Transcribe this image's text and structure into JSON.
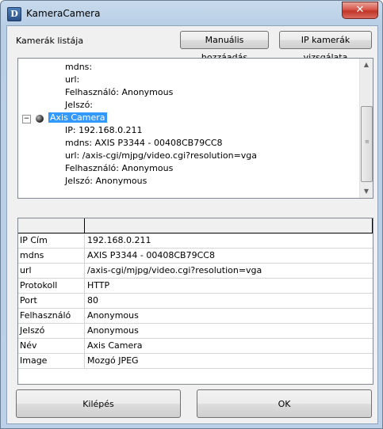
{
  "window": {
    "title": "KameraCamera",
    "close_label": "✕"
  },
  "header": {
    "cameras_label": "Kamerák listája",
    "manual_add_label": "Manuális hozzáadás",
    "scan_label": "IP kamerák vizsgálata"
  },
  "tree": {
    "prev_lines": [
      "mdns:",
      "url:",
      "Felhasználó: Anonymous",
      "Jelszó:"
    ],
    "camera_name": "Axis Camera",
    "camera_lines": [
      "IP: 192.168.0.211",
      "mdns: AXIS P3344 - 00408CB79CC8",
      "url: /axis-cgi/mjpg/video.cgi?resolution=vga",
      "Felhasználó: Anonymous",
      "Jelszó: Anonymous"
    ],
    "expander": "−"
  },
  "properties": [
    {
      "key": "IP Cím",
      "value": "192.168.0.211"
    },
    {
      "key": "mdns",
      "value": "AXIS P3344 - 00408CB79CC8"
    },
    {
      "key": "url",
      "value": "/axis-cgi/mjpg/video.cgi?resolution=vga"
    },
    {
      "key": "Protokoll",
      "value": "HTTP"
    },
    {
      "key": "Port",
      "value": "80"
    },
    {
      "key": "Felhasználó",
      "value": "Anonymous"
    },
    {
      "key": "Jelszó",
      "value": "Anonymous"
    },
    {
      "key": "Név",
      "value": "Axis Camera"
    },
    {
      "key": "Image",
      "value": "Mozgó JPEG"
    }
  ],
  "footer": {
    "exit_label": "Kilépés",
    "ok_label": "OK"
  },
  "colors": {
    "selection": "#3399ff",
    "close": "#c03627"
  }
}
